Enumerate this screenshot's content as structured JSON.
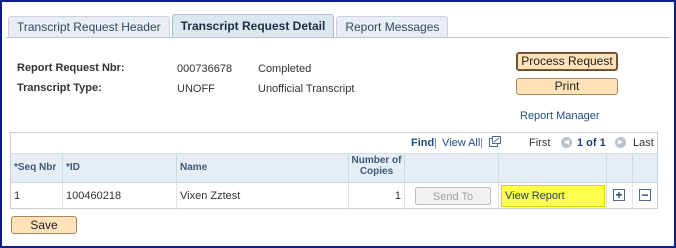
{
  "tabs": [
    {
      "label": "Transcript Request Header",
      "active": false
    },
    {
      "label": "Transcript Request Detail",
      "active": true
    },
    {
      "label": "Report Messages",
      "active": false
    }
  ],
  "info": {
    "report_request_nbr_label": "Report Request Nbr:",
    "report_request_nbr_value": "000736678",
    "report_status": "Completed",
    "transcript_type_label": "Transcript Type:",
    "transcript_type_code": "UNOFF",
    "transcript_type_desc": "Unofficial Transcript"
  },
  "buttons": {
    "process_request": "Process Request",
    "print": "Print",
    "save": "Save"
  },
  "links": {
    "report_manager": "Report Manager"
  },
  "grid": {
    "nav": {
      "find": "Find",
      "separator": "|",
      "view_all": "View All",
      "separator2": "|",
      "first": "First",
      "page_info": "1 of 1",
      "last": "Last"
    },
    "columns": [
      "*Seq Nbr",
      "*ID",
      "Name",
      "Number of Copies"
    ],
    "rows": [
      {
        "seq_nbr": "1",
        "id": "100460218",
        "name": "Vixen Zztest",
        "copies": "1",
        "send_to": "Send To",
        "view_report": "View Report",
        "add": "+",
        "delete": "−"
      }
    ],
    "highlight_color": "#ffff4d"
  }
}
